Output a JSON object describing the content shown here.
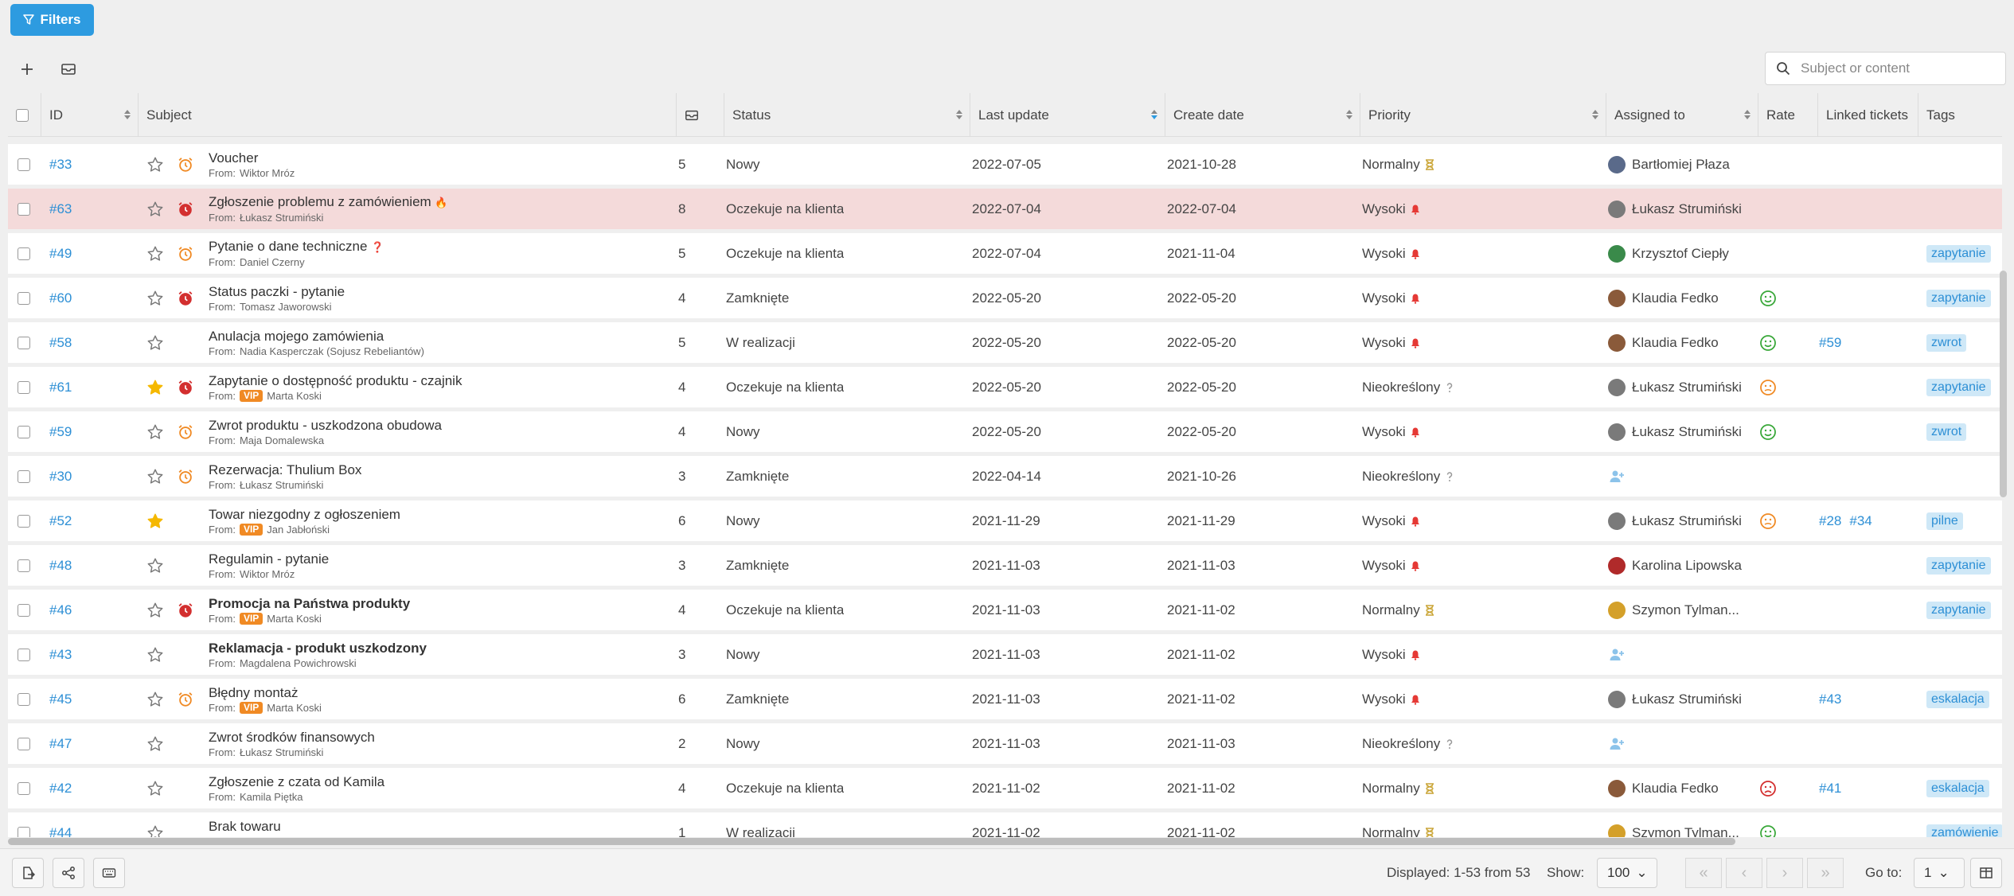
{
  "toolbar": {
    "filters_label": "Filters",
    "search_placeholder": "Subject or content"
  },
  "columns": {
    "id": "ID",
    "subject": "Subject",
    "status": "Status",
    "last_update": "Last update",
    "create_date": "Create date",
    "priority": "Priority",
    "assigned_to": "Assigned to",
    "rate": "Rate",
    "linked_tickets": "Linked tickets",
    "tags": "Tags"
  },
  "tickets": [
    {
      "id": "#33",
      "starred": false,
      "alarm": "orange",
      "subject": "Voucher",
      "bold": false,
      "emoji": "",
      "vip": false,
      "from_prefix": "From:",
      "from": "Wiktor Mróz",
      "count": "5",
      "status": "Nowy",
      "last_update": "2022-07-05",
      "create_date": "2021-10-28",
      "priority": "Normalny",
      "priority_icon": "hourglass-icon",
      "assignee": "Bartłomiej Płaza",
      "avatar_color": "#5a6a8a",
      "rate": "",
      "links": [],
      "tag": "",
      "highlight": false
    },
    {
      "id": "#63",
      "starred": false,
      "alarm": "red",
      "subject": "Zgłoszenie problemu z zamówieniem",
      "bold": false,
      "emoji": "🔥",
      "vip": false,
      "from_prefix": "From:",
      "from": "Łukasz Strumiński",
      "count": "8",
      "status": "Oczekuje na klienta",
      "last_update": "2022-07-04",
      "create_date": "2022-07-04",
      "priority": "Wysoki",
      "priority_icon": "alert-icon",
      "assignee": "Łukasz Strumiński",
      "avatar_color": "#7a7a7a",
      "rate": "",
      "links": [],
      "tag": "",
      "highlight": true
    },
    {
      "id": "#49",
      "starred": false,
      "alarm": "orange",
      "subject": "Pytanie o dane techniczne",
      "bold": false,
      "emoji": "❓",
      "vip": false,
      "from_prefix": "From:",
      "from": "Daniel Czerny",
      "count": "5",
      "status": "Oczekuje na klienta",
      "last_update": "2022-07-04",
      "create_date": "2021-11-04",
      "priority": "Wysoki",
      "priority_icon": "alert-icon",
      "assignee": "Krzysztof Ciepły",
      "avatar_color": "#3a8a4a",
      "rate": "",
      "links": [],
      "tag": "zapytanie",
      "highlight": false
    },
    {
      "id": "#60",
      "starred": false,
      "alarm": "red",
      "subject": "Status paczki - pytanie",
      "bold": false,
      "emoji": "",
      "vip": false,
      "from_prefix": "From:",
      "from": "Tomasz Jaworowski",
      "count": "4",
      "status": "Zamknięte",
      "last_update": "2022-05-20",
      "create_date": "2022-05-20",
      "priority": "Wysoki",
      "priority_icon": "alert-icon",
      "assignee": "Klaudia Fedko",
      "avatar_color": "#8a5a3a",
      "rate": "happy",
      "links": [],
      "tag": "zapytanie",
      "highlight": false
    },
    {
      "id": "#58",
      "starred": false,
      "alarm": "",
      "subject": "Anulacja mojego zamówienia",
      "bold": false,
      "emoji": "",
      "vip": false,
      "from_prefix": "From:",
      "from": "Nadia Kasperczak (Sojusz Rebeliantów)",
      "count": "5",
      "status": "W realizacji",
      "last_update": "2022-05-20",
      "create_date": "2022-05-20",
      "priority": "Wysoki",
      "priority_icon": "alert-icon",
      "assignee": "Klaudia Fedko",
      "avatar_color": "#8a5a3a",
      "rate": "happy",
      "links": [
        "#59"
      ],
      "tag": "zwrot",
      "highlight": false
    },
    {
      "id": "#61",
      "starred": true,
      "alarm": "red",
      "subject": "Zapytanie o dostępność produktu - czajnik",
      "bold": false,
      "emoji": "",
      "vip": true,
      "from_prefix": "From:",
      "from": "Marta Koski",
      "count": "4",
      "status": "Oczekuje na klienta",
      "last_update": "2022-05-20",
      "create_date": "2022-05-20",
      "priority": "Nieokreślony",
      "priority_icon": "question-icon",
      "assignee": "Łukasz Strumiński",
      "avatar_color": "#7a7a7a",
      "rate": "neutral",
      "links": [],
      "tag": "zapytanie",
      "highlight": false
    },
    {
      "id": "#59",
      "starred": false,
      "alarm": "orange",
      "subject": "Zwrot produktu - uszkodzona obudowa",
      "bold": false,
      "emoji": "",
      "vip": false,
      "from_prefix": "From:",
      "from": "Maja Domalewska",
      "count": "4",
      "status": "Nowy",
      "last_update": "2022-05-20",
      "create_date": "2022-05-20",
      "priority": "Wysoki",
      "priority_icon": "alert-icon",
      "assignee": "Łukasz Strumiński",
      "avatar_color": "#7a7a7a",
      "rate": "happy",
      "links": [],
      "tag": "zwrot",
      "highlight": false
    },
    {
      "id": "#30",
      "starred": false,
      "alarm": "orange",
      "subject": "Rezerwacja: Thulium Box",
      "bold": false,
      "emoji": "",
      "vip": false,
      "from_prefix": "From:",
      "from": "Łukasz Strumiński",
      "count": "3",
      "status": "Zamknięte",
      "last_update": "2022-04-14",
      "create_date": "2021-10-26",
      "priority": "Nieokreślony",
      "priority_icon": "question-icon",
      "assignee": "",
      "avatar_color": "",
      "rate": "",
      "links": [],
      "tag": "",
      "highlight": false
    },
    {
      "id": "#52",
      "starred": true,
      "alarm": "",
      "subject": "Towar niezgodny z ogłoszeniem",
      "bold": false,
      "emoji": "",
      "vip": true,
      "from_prefix": "From:",
      "from": "Jan Jabłoński",
      "count": "6",
      "status": "Nowy",
      "last_update": "2021-11-29",
      "create_date": "2021-11-29",
      "priority": "Wysoki",
      "priority_icon": "alert-icon",
      "assignee": "Łukasz Strumiński",
      "avatar_color": "#7a7a7a",
      "rate": "neutral",
      "links": [
        "#28",
        "#34"
      ],
      "tag": "pilne",
      "highlight": false
    },
    {
      "id": "#48",
      "starred": false,
      "alarm": "",
      "subject": "Regulamin - pytanie",
      "bold": false,
      "emoji": "",
      "vip": false,
      "from_prefix": "From:",
      "from": "Wiktor Mróz",
      "count": "3",
      "status": "Zamknięte",
      "last_update": "2021-11-03",
      "create_date": "2021-11-03",
      "priority": "Wysoki",
      "priority_icon": "alert-icon",
      "assignee": "Karolina Lipowska",
      "avatar_color": "#b02a2a",
      "rate": "",
      "links": [],
      "tag": "zapytanie",
      "highlight": false
    },
    {
      "id": "#46",
      "starred": false,
      "alarm": "red",
      "subject": "Promocja na Państwa produkty",
      "bold": true,
      "emoji": "",
      "vip": true,
      "from_prefix": "From:",
      "from": "Marta Koski",
      "count": "4",
      "status": "Oczekuje na klienta",
      "last_update": "2021-11-03",
      "create_date": "2021-11-02",
      "priority": "Normalny",
      "priority_icon": "hourglass-icon",
      "assignee": "Szymon Tylman...",
      "avatar_color": "#d4a02a",
      "rate": "",
      "links": [],
      "tag": "zapytanie",
      "highlight": false
    },
    {
      "id": "#43",
      "starred": false,
      "alarm": "",
      "subject": "Reklamacja - produkt uszkodzony",
      "bold": true,
      "emoji": "",
      "vip": false,
      "from_prefix": "From:",
      "from": "Magdalena Powichrowski",
      "count": "3",
      "status": "Nowy",
      "last_update": "2021-11-03",
      "create_date": "2021-11-02",
      "priority": "Wysoki",
      "priority_icon": "alert-icon",
      "assignee": "",
      "avatar_color": "",
      "rate": "",
      "links": [],
      "tag": "",
      "highlight": false
    },
    {
      "id": "#45",
      "starred": false,
      "alarm": "orange",
      "subject": "Błędny montaż",
      "bold": false,
      "emoji": "",
      "vip": true,
      "from_prefix": "From:",
      "from": "Marta Koski",
      "count": "6",
      "status": "Zamknięte",
      "last_update": "2021-11-03",
      "create_date": "2021-11-02",
      "priority": "Wysoki",
      "priority_icon": "alert-icon",
      "assignee": "Łukasz Strumiński",
      "avatar_color": "#7a7a7a",
      "rate": "",
      "links": [
        "#43"
      ],
      "tag": "eskalacja",
      "highlight": false
    },
    {
      "id": "#47",
      "starred": false,
      "alarm": "",
      "subject": "Zwrot środków finansowych",
      "bold": false,
      "emoji": "",
      "vip": false,
      "from_prefix": "From:",
      "from": "Łukasz Strumiński",
      "count": "2",
      "status": "Nowy",
      "last_update": "2021-11-03",
      "create_date": "2021-11-03",
      "priority": "Nieokreślony",
      "priority_icon": "question-icon",
      "assignee": "",
      "avatar_color": "",
      "rate": "",
      "links": [],
      "tag": "",
      "highlight": false
    },
    {
      "id": "#42",
      "starred": false,
      "alarm": "",
      "subject": "Zgłoszenie z czata od Kamila",
      "bold": false,
      "emoji": "",
      "vip": false,
      "from_prefix": "From:",
      "from": "Kamila Piętka",
      "count": "4",
      "status": "Oczekuje na klienta",
      "last_update": "2021-11-02",
      "create_date": "2021-11-02",
      "priority": "Normalny",
      "priority_icon": "hourglass-icon",
      "assignee": "Klaudia Fedko",
      "avatar_color": "#8a5a3a",
      "rate": "sad",
      "links": [
        "#41"
      ],
      "tag": "eskalacja",
      "highlight": false
    },
    {
      "id": "#44",
      "starred": false,
      "alarm": "",
      "subject": "Brak towaru",
      "bold": false,
      "emoji": "",
      "vip": false,
      "from_prefix": "From:",
      "from": "",
      "count": "1",
      "status": "W realizacji",
      "last_update": "2021-11-02",
      "create_date": "2021-11-02",
      "priority": "Normalny",
      "priority_icon": "hourglass-icon",
      "assignee": "Szymon Tylman...",
      "avatar_color": "#d4a02a",
      "rate": "happy",
      "links": [],
      "tag": "zamówienie",
      "highlight": false
    }
  ],
  "colors": {
    "accent": "#2d9be0",
    "link": "#2d8fd5",
    "star": "#f5b800",
    "alarm_orange": "#f08a24",
    "alarm_red": "#d32f2f",
    "vip": "#f08a24",
    "happy": "#3aa83a",
    "neutral": "#f08a24",
    "sad": "#d32f2f",
    "highlight_row": "#f4dada"
  },
  "footer": {
    "displayed": "Displayed: 1-53 from 53",
    "show_label": "Show:",
    "show_value": "100",
    "goto_label": "Go to:",
    "goto_value": "1"
  }
}
